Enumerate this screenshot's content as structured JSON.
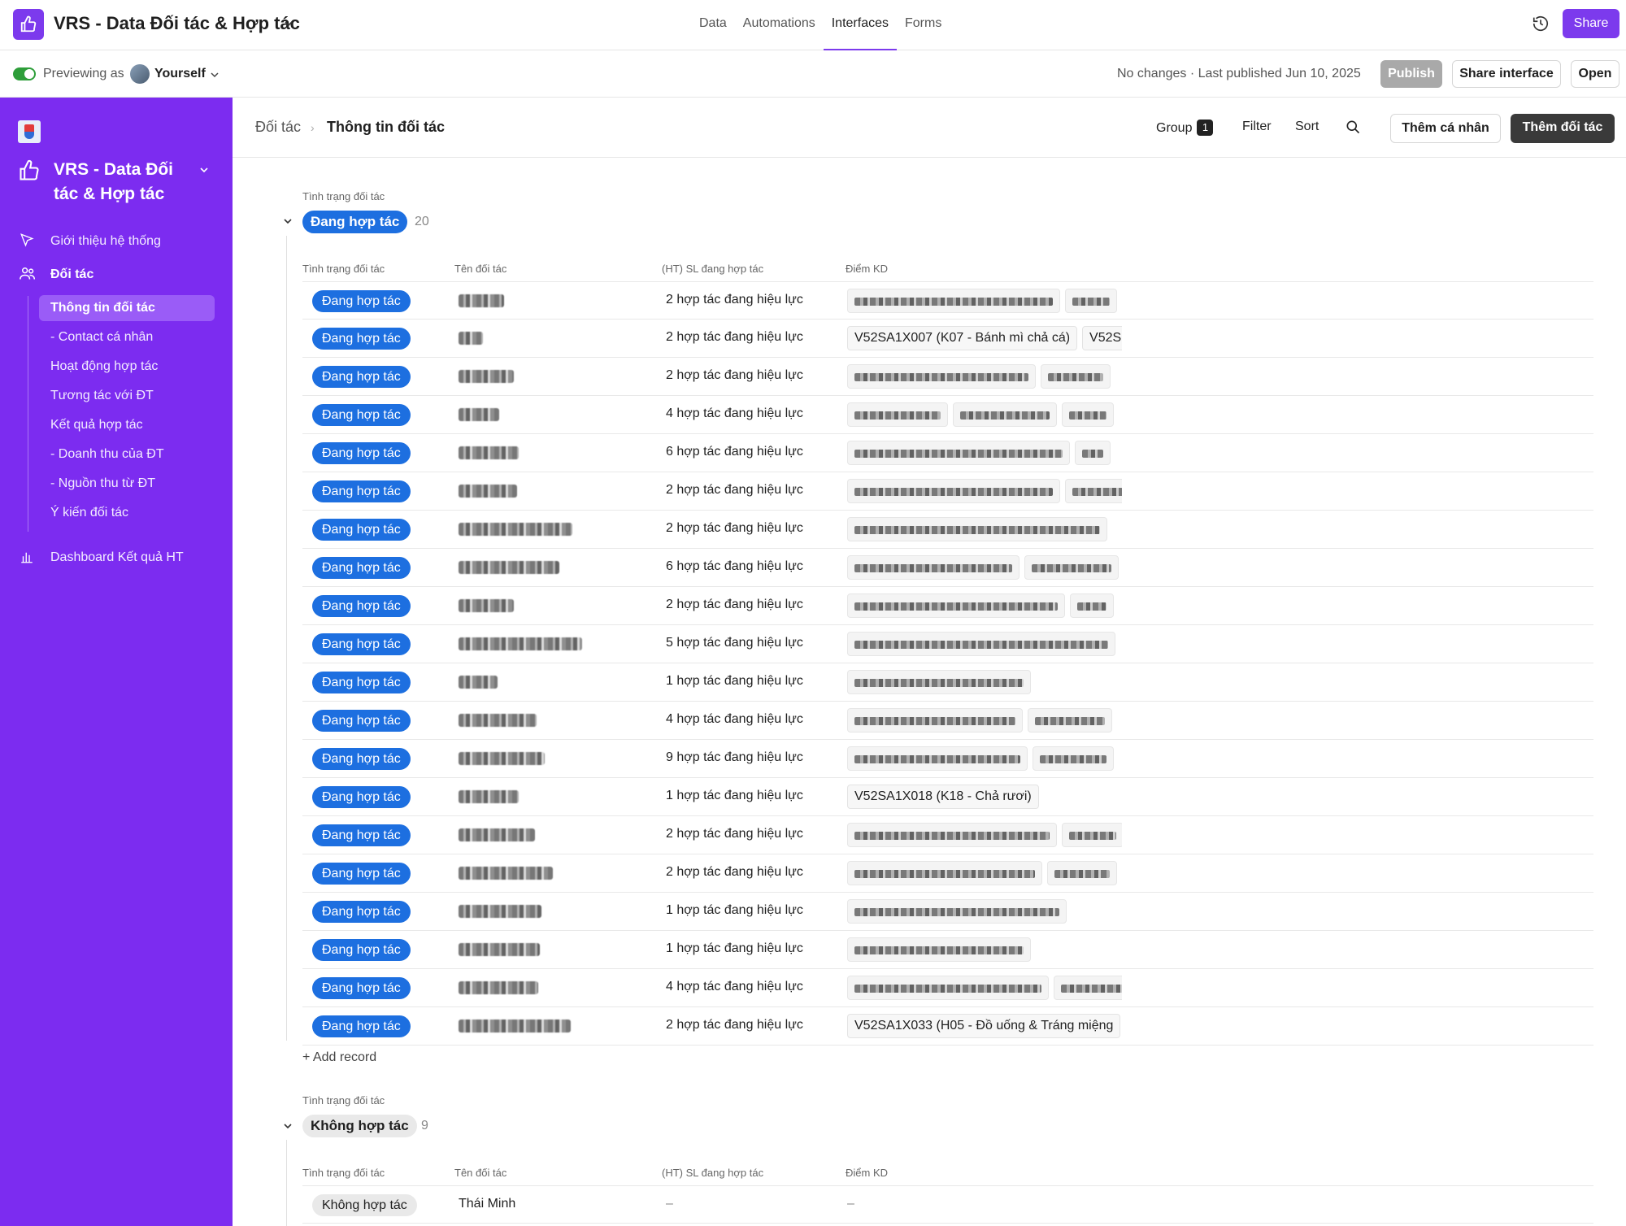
{
  "app": {
    "title": "VRS - Data Đối tác & Hợp tác",
    "nav": [
      {
        "label": "Data",
        "active": false
      },
      {
        "label": "Automations",
        "active": false
      },
      {
        "label": "Interfaces",
        "active": true
      },
      {
        "label": "Forms",
        "active": false
      }
    ],
    "share_label": "Share",
    "accent": "#7c3aed"
  },
  "preview": {
    "label": "Previewing as",
    "user": "Yourself",
    "status": "No changes · Last published Jun 10, 2025",
    "publish_label": "Publish",
    "share_interface_label": "Share interface",
    "open_label": "Open"
  },
  "sidebar": {
    "title": "VRS - Data Đối tác & Hợp tác",
    "items": [
      {
        "label": "Giới thiệu hệ thống",
        "icon": "pointer-icon"
      },
      {
        "label": "Đối tác",
        "icon": "people-icon"
      },
      {
        "label": "Thông tin đối tác"
      },
      {
        "label": "- Contact cá nhân"
      },
      {
        "label": "Hoạt động hợp tác"
      },
      {
        "label": "Tương tác với ĐT"
      },
      {
        "label": "Kết quả hợp tác"
      },
      {
        "label": "- Doanh thu của ĐT"
      },
      {
        "label": "- Nguồn thu từ ĐT"
      },
      {
        "label": "Ý kiến đối tác"
      },
      {
        "label": "Dashboard Kết quả HT",
        "icon": "bar-chart-icon"
      }
    ]
  },
  "header": {
    "breadcrumb_parent": "Đối tác",
    "breadcrumb_current": "Thông tin đối tác",
    "group_label": "Group",
    "group_count": "1",
    "filter_label": "Filter",
    "sort_label": "Sort",
    "add_person_label": "Thêm cá nhân",
    "add_partner_label": "Thêm đối tác"
  },
  "columns": {
    "status": "Tình trạng đối tác",
    "name": "Tên đối tác",
    "count": "(HT) SL đang hợp tác",
    "kd": "Điểm KD"
  },
  "groups": [
    {
      "caption": "Tình trạng đối tác",
      "label": "Đang hợp tác",
      "count": "20",
      "rows": [
        {
          "status": "Đang hợp tác",
          "count": "2 hợp tác đang hiệu lực",
          "kd": []
        },
        {
          "status": "Đang hợp tác",
          "count": "2 hợp tác đang hiệu lực",
          "kd": [
            "V52SA1X007 (K07 - Bánh mì chả cá)",
            "V52S"
          ]
        },
        {
          "status": "Đang hợp tác",
          "count": "2 hợp tác đang hiệu lực",
          "kd": []
        },
        {
          "status": "Đang hợp tác",
          "count": "4 hợp tác đang hiệu lực",
          "kd": []
        },
        {
          "status": "Đang hợp tác",
          "count": "6 hợp tác đang hiệu lực",
          "kd": []
        },
        {
          "status": "Đang hợp tác",
          "count": "2 hợp tác đang hiệu lực",
          "kd": []
        },
        {
          "status": "Đang hợp tác",
          "count": "2 hợp tác đang hiệu lực",
          "kd": []
        },
        {
          "status": "Đang hợp tác",
          "count": "6 hợp tác đang hiệu lực",
          "kd": []
        },
        {
          "status": "Đang hợp tác",
          "count": "2 hợp tác đang hiệu lực",
          "kd": []
        },
        {
          "status": "Đang hợp tác",
          "count": "5 hợp tác đang hiệu lực",
          "kd": []
        },
        {
          "status": "Đang hợp tác",
          "count": "1 hợp tác đang hiệu lực",
          "kd": []
        },
        {
          "status": "Đang hợp tác",
          "count": "4 hợp tác đang hiệu lực",
          "kd": []
        },
        {
          "status": "Đang hợp tác",
          "count": "9 hợp tác đang hiệu lực",
          "kd": []
        },
        {
          "status": "Đang hợp tác",
          "count": "1 hợp tác đang hiệu lực",
          "kd": [
            "V52SA1X018 (K18 - Chả rươi)"
          ]
        },
        {
          "status": "Đang hợp tác",
          "count": "2 hợp tác đang hiệu lực",
          "kd": []
        },
        {
          "status": "Đang hợp tác",
          "count": "2 hợp tác đang hiệu lực",
          "kd": []
        },
        {
          "status": "Đang hợp tác",
          "count": "1 hợp tác đang hiệu lực",
          "kd": []
        },
        {
          "status": "Đang hợp tác",
          "count": "1 hợp tác đang hiệu lực",
          "kd": []
        },
        {
          "status": "Đang hợp tác",
          "count": "4 hợp tác đang hiệu lực",
          "kd": []
        },
        {
          "status": "Đang hợp tác",
          "count": "2 hợp tác đang hiệu lực",
          "kd": [
            "V52SA1X033 (H05 - Đồ uống & Tráng miệng"
          ]
        }
      ],
      "add_record_label": "Add record"
    },
    {
      "caption": "Tình trạng đối tác",
      "label": "Không hợp tác",
      "count": "9",
      "rows": [
        {
          "status": "Không hợp tác",
          "name": "Thái Minh",
          "count": "–",
          "kd": "–"
        }
      ]
    }
  ]
}
